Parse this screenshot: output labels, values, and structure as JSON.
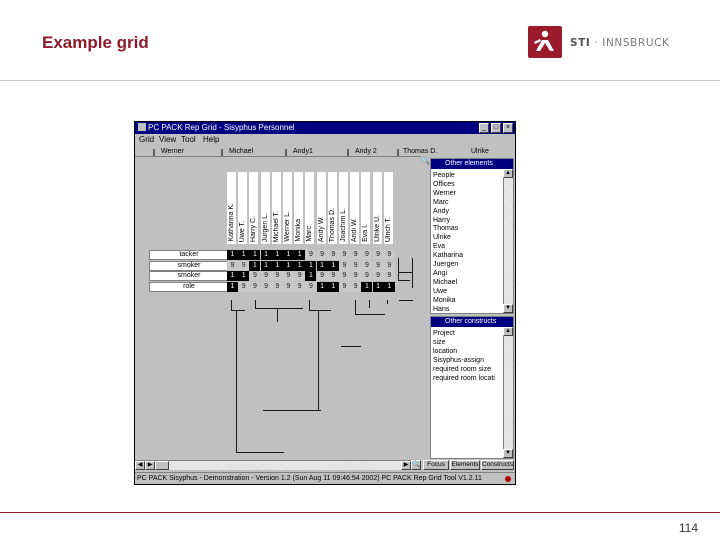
{
  "slide": {
    "title": "Example grid",
    "page_number": "114",
    "logo_text_bold": "STI",
    "logo_text": " · INNSBRUCK",
    "brand_color": "#9a1b2c"
  },
  "app": {
    "title": "PC PACK Rep Grid - Sisyphus Personnel",
    "menu": [
      "Grid",
      "View",
      "Tool",
      "Help"
    ],
    "column_header_labels": [
      "Werner",
      "Michael",
      "Andy1",
      "Andy 2",
      "Thomas D.",
      "Ulrike"
    ],
    "element_labels": [
      "Katharina K.",
      "Uwe T.",
      "Harry C.",
      "Jurgen L.",
      "Michael T.",
      "Werner L.",
      "Monika",
      "Marc",
      "Andy W.",
      "Thomas D.",
      "Joachim L.",
      "Andi W.",
      "Eva I.",
      "Ulrike U.",
      "Ulrich T."
    ],
    "row_labels": [
      "tacker",
      "smoker",
      "smoker",
      "role"
    ],
    "grid_rows": [
      [
        "1",
        "1",
        "1",
        "1",
        "1",
        "1",
        "1",
        "9",
        "9",
        "9",
        "9",
        "9",
        "9",
        "9",
        "9"
      ],
      [
        "9",
        "9",
        "1",
        "1",
        "1",
        "1",
        "1",
        "1",
        "1",
        "1",
        "9",
        "9",
        "9",
        "9",
        "9"
      ],
      [
        "1",
        "1",
        "9",
        "9",
        "9",
        "9",
        "9",
        "1",
        "9",
        "9",
        "9",
        "9",
        "9",
        "9",
        "9"
      ],
      [
        "1",
        "9",
        "9",
        "9",
        "9",
        "9",
        "9",
        "9",
        "1",
        "1",
        "9",
        "9",
        "1",
        "1",
        "1"
      ]
    ],
    "grid_dark": [
      [
        1,
        1,
        1,
        1,
        1,
        1,
        1,
        0,
        0,
        0,
        0,
        0,
        0,
        0,
        0
      ],
      [
        0,
        0,
        1,
        1,
        1,
        1,
        1,
        1,
        1,
        1,
        0,
        0,
        0,
        0,
        0
      ],
      [
        1,
        1,
        0,
        0,
        0,
        0,
        0,
        1,
        0,
        0,
        0,
        0,
        0,
        0,
        0
      ],
      [
        1,
        0,
        0,
        0,
        0,
        0,
        0,
        0,
        1,
        1,
        0,
        0,
        1,
        1,
        1
      ]
    ],
    "elements_panel": {
      "header": "Other elements",
      "items": [
        "People",
        "Offices",
        "Werner",
        "Marc",
        "Andy",
        "Harry",
        "Thomas",
        "Ulrike",
        "Eva",
        "Katharina",
        "Juergen",
        "Angi",
        "Michael",
        "Uwe",
        "Monika",
        "Hans"
      ]
    },
    "constructs_panel": {
      "header": "Other constructs",
      "items": [
        "Project",
        "size",
        "location",
        "Sisyphus-assign",
        "required room size",
        "required room locati"
      ]
    },
    "bottom_tabs": [
      "Focus",
      "Elements",
      "Constructs"
    ],
    "status_text": "PC PACK Sisyphus - Demonstration - Version 1.2 (Sun Aug 11 09:46:54 2002) PC PACK Rep Grid Tool V1.2.11"
  }
}
